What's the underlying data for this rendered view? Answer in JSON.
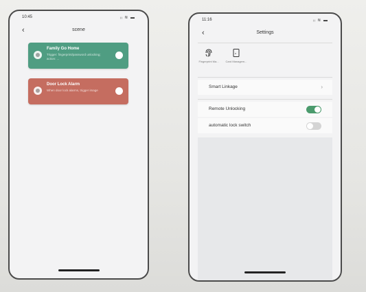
{
  "left_phone": {
    "status_time": "10:45",
    "status_icons": "ᵢᵢ ≋ ▬",
    "back_glyph": "‹",
    "title": "scene",
    "cards": [
      {
        "title": "Family Go Home",
        "description": "Trigger: fingerprint/password unlocking; action: ...",
        "color": "#4f9d82"
      },
      {
        "title": "Door Lock Alarm",
        "description": "When door lock alarms, trigger image",
        "color": "#c56d60"
      }
    ]
  },
  "right_phone": {
    "status_time": "11:16",
    "status_icons": "ᵢᵢ ≋ ▬",
    "back_glyph": "‹",
    "title": "Settings",
    "icons": [
      {
        "icon": "fingerprint-icon",
        "label": "Fingerprint Ma..."
      },
      {
        "icon": "card-icon",
        "label": "Card Managem..."
      }
    ],
    "smart_linkage": {
      "label": "Smart Linkage",
      "chevron": "›"
    },
    "remote_unlocking": {
      "label": "Remote Unlocking",
      "on": true
    },
    "automatic_lock_switch": {
      "label": "automatic lock switch",
      "on": false
    },
    "accent_color": "#4b9b6d"
  }
}
